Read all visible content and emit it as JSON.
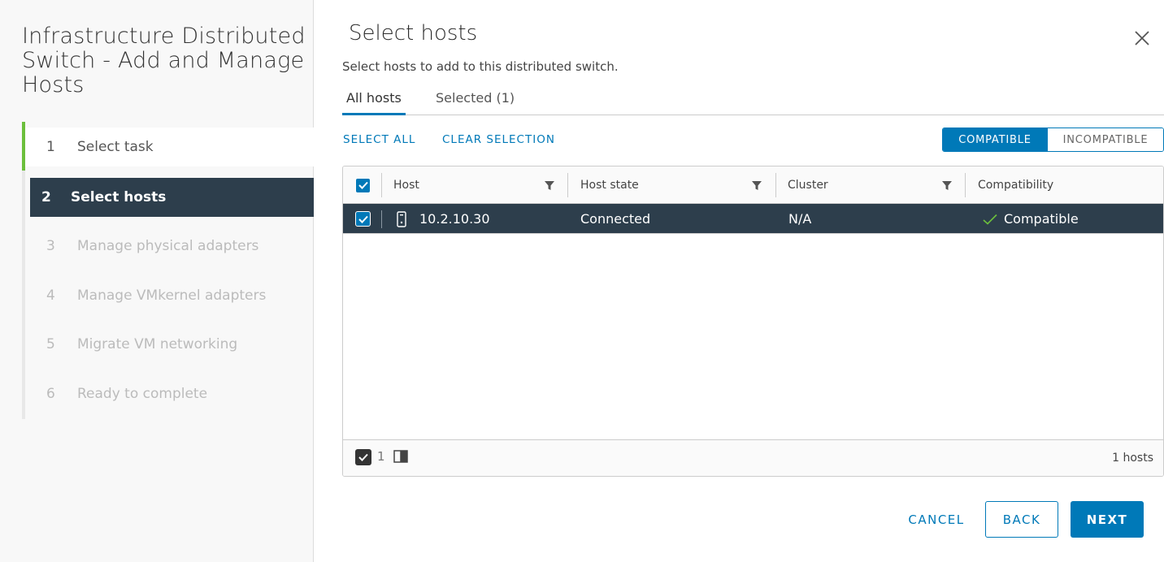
{
  "wizard": {
    "title": "Infrastructure Distributed Switch - Add and Manage Hosts",
    "steps": [
      {
        "num": "1",
        "label": "Select task"
      },
      {
        "num": "2",
        "label": "Select hosts"
      },
      {
        "num": "3",
        "label": "Manage physical adapters"
      },
      {
        "num": "4",
        "label": "Manage VMkernel adapters"
      },
      {
        "num": "5",
        "label": "Migrate VM networking"
      },
      {
        "num": "6",
        "label": "Ready to complete"
      }
    ],
    "active_step": 2
  },
  "page": {
    "title": "Select hosts",
    "subtitle": "Select hosts to add to this distributed switch."
  },
  "tabs": [
    {
      "label": "All hosts",
      "active": true
    },
    {
      "label": "Selected (1)",
      "active": false
    }
  ],
  "actions": {
    "select_all": "SELECT ALL",
    "clear_selection": "CLEAR SELECTION"
  },
  "filter_toggle": {
    "compatible": "COMPATIBLE",
    "incompatible": "INCOMPATIBLE",
    "selected": "compatible"
  },
  "grid": {
    "columns": [
      "Host",
      "Host state",
      "Cluster",
      "Compatibility"
    ],
    "rows": [
      {
        "host": "10.2.10.30",
        "state": "Connected",
        "cluster": "N/A",
        "compatibility": "Compatible",
        "selected": true
      }
    ],
    "footer": {
      "selected_count": "1",
      "total": "1 hosts"
    }
  },
  "buttons": {
    "cancel": "CANCEL",
    "back": "BACK",
    "next": "NEXT"
  },
  "colors": {
    "accent": "#0079b8",
    "active_row": "#2d3e4c",
    "step_done": "#6cbf3c",
    "compatible_check": "#6cbf3c"
  }
}
